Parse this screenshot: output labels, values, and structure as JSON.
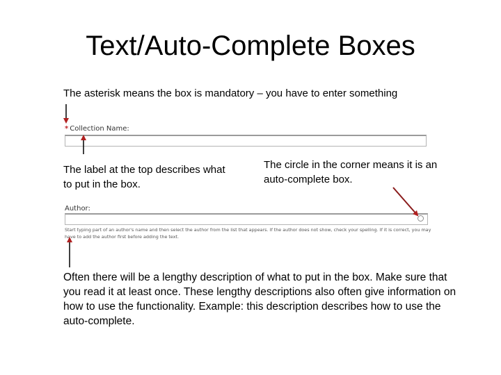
{
  "slide": {
    "title": "Text/Auto-Complete Boxes"
  },
  "captions": {
    "asterisk": "The asterisk means the box is mandatory – you have to enter something",
    "label": "The label at the top describes what to put in the box.",
    "circle": "The circle in the corner means it is an auto-complete box.",
    "description": "Often there will be a lengthy description of what to put in the box. Make sure that you read it at least once. These lengthy descriptions also often give information on how to use the functionality. Example: this description describes how to use the auto-complete."
  },
  "form": {
    "collection": {
      "required_marker": "*",
      "label": "Collection Name:",
      "value": ""
    },
    "author": {
      "label": "Author:",
      "value": "",
      "help": "Start typing part of an author's name and then select the author from the list that appears. If the author does not show, check your spelling. If it is correct, you may have to add the author first before adding the text."
    }
  },
  "colors": {
    "arrow_line": "#000000",
    "arrow_red": "#b02020",
    "required": "#c0282e"
  }
}
